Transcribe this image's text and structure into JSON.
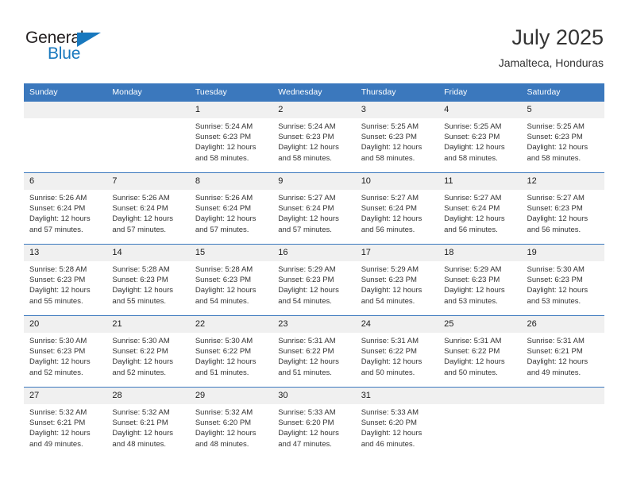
{
  "brand": {
    "name_top": "General",
    "name_bottom": "Blue",
    "color_blue": "#1878be",
    "color_dark": "#231f20"
  },
  "header": {
    "month_title": "July 2025",
    "location": "Jamalteca, Honduras",
    "header_bg": "#3b78bd",
    "date_band_bg": "#f0f0f0"
  },
  "weekdays": [
    "Sunday",
    "Monday",
    "Tuesday",
    "Wednesday",
    "Thursday",
    "Friday",
    "Saturday"
  ],
  "weeks": [
    [
      {
        "day": "",
        "lines": []
      },
      {
        "day": "",
        "lines": []
      },
      {
        "day": "1",
        "lines": [
          "Sunrise: 5:24 AM",
          "Sunset: 6:23 PM",
          "Daylight: 12 hours",
          "and 58 minutes."
        ]
      },
      {
        "day": "2",
        "lines": [
          "Sunrise: 5:24 AM",
          "Sunset: 6:23 PM",
          "Daylight: 12 hours",
          "and 58 minutes."
        ]
      },
      {
        "day": "3",
        "lines": [
          "Sunrise: 5:25 AM",
          "Sunset: 6:23 PM",
          "Daylight: 12 hours",
          "and 58 minutes."
        ]
      },
      {
        "day": "4",
        "lines": [
          "Sunrise: 5:25 AM",
          "Sunset: 6:23 PM",
          "Daylight: 12 hours",
          "and 58 minutes."
        ]
      },
      {
        "day": "5",
        "lines": [
          "Sunrise: 5:25 AM",
          "Sunset: 6:23 PM",
          "Daylight: 12 hours",
          "and 58 minutes."
        ]
      }
    ],
    [
      {
        "day": "6",
        "lines": [
          "Sunrise: 5:26 AM",
          "Sunset: 6:24 PM",
          "Daylight: 12 hours",
          "and 57 minutes."
        ]
      },
      {
        "day": "7",
        "lines": [
          "Sunrise: 5:26 AM",
          "Sunset: 6:24 PM",
          "Daylight: 12 hours",
          "and 57 minutes."
        ]
      },
      {
        "day": "8",
        "lines": [
          "Sunrise: 5:26 AM",
          "Sunset: 6:24 PM",
          "Daylight: 12 hours",
          "and 57 minutes."
        ]
      },
      {
        "day": "9",
        "lines": [
          "Sunrise: 5:27 AM",
          "Sunset: 6:24 PM",
          "Daylight: 12 hours",
          "and 57 minutes."
        ]
      },
      {
        "day": "10",
        "lines": [
          "Sunrise: 5:27 AM",
          "Sunset: 6:24 PM",
          "Daylight: 12 hours",
          "and 56 minutes."
        ]
      },
      {
        "day": "11",
        "lines": [
          "Sunrise: 5:27 AM",
          "Sunset: 6:24 PM",
          "Daylight: 12 hours",
          "and 56 minutes."
        ]
      },
      {
        "day": "12",
        "lines": [
          "Sunrise: 5:27 AM",
          "Sunset: 6:23 PM",
          "Daylight: 12 hours",
          "and 56 minutes."
        ]
      }
    ],
    [
      {
        "day": "13",
        "lines": [
          "Sunrise: 5:28 AM",
          "Sunset: 6:23 PM",
          "Daylight: 12 hours",
          "and 55 minutes."
        ]
      },
      {
        "day": "14",
        "lines": [
          "Sunrise: 5:28 AM",
          "Sunset: 6:23 PM",
          "Daylight: 12 hours",
          "and 55 minutes."
        ]
      },
      {
        "day": "15",
        "lines": [
          "Sunrise: 5:28 AM",
          "Sunset: 6:23 PM",
          "Daylight: 12 hours",
          "and 54 minutes."
        ]
      },
      {
        "day": "16",
        "lines": [
          "Sunrise: 5:29 AM",
          "Sunset: 6:23 PM",
          "Daylight: 12 hours",
          "and 54 minutes."
        ]
      },
      {
        "day": "17",
        "lines": [
          "Sunrise: 5:29 AM",
          "Sunset: 6:23 PM",
          "Daylight: 12 hours",
          "and 54 minutes."
        ]
      },
      {
        "day": "18",
        "lines": [
          "Sunrise: 5:29 AM",
          "Sunset: 6:23 PM",
          "Daylight: 12 hours",
          "and 53 minutes."
        ]
      },
      {
        "day": "19",
        "lines": [
          "Sunrise: 5:30 AM",
          "Sunset: 6:23 PM",
          "Daylight: 12 hours",
          "and 53 minutes."
        ]
      }
    ],
    [
      {
        "day": "20",
        "lines": [
          "Sunrise: 5:30 AM",
          "Sunset: 6:23 PM",
          "Daylight: 12 hours",
          "and 52 minutes."
        ]
      },
      {
        "day": "21",
        "lines": [
          "Sunrise: 5:30 AM",
          "Sunset: 6:22 PM",
          "Daylight: 12 hours",
          "and 52 minutes."
        ]
      },
      {
        "day": "22",
        "lines": [
          "Sunrise: 5:30 AM",
          "Sunset: 6:22 PM",
          "Daylight: 12 hours",
          "and 51 minutes."
        ]
      },
      {
        "day": "23",
        "lines": [
          "Sunrise: 5:31 AM",
          "Sunset: 6:22 PM",
          "Daylight: 12 hours",
          "and 51 minutes."
        ]
      },
      {
        "day": "24",
        "lines": [
          "Sunrise: 5:31 AM",
          "Sunset: 6:22 PM",
          "Daylight: 12 hours",
          "and 50 minutes."
        ]
      },
      {
        "day": "25",
        "lines": [
          "Sunrise: 5:31 AM",
          "Sunset: 6:22 PM",
          "Daylight: 12 hours",
          "and 50 minutes."
        ]
      },
      {
        "day": "26",
        "lines": [
          "Sunrise: 5:31 AM",
          "Sunset: 6:21 PM",
          "Daylight: 12 hours",
          "and 49 minutes."
        ]
      }
    ],
    [
      {
        "day": "27",
        "lines": [
          "Sunrise: 5:32 AM",
          "Sunset: 6:21 PM",
          "Daylight: 12 hours",
          "and 49 minutes."
        ]
      },
      {
        "day": "28",
        "lines": [
          "Sunrise: 5:32 AM",
          "Sunset: 6:21 PM",
          "Daylight: 12 hours",
          "and 48 minutes."
        ]
      },
      {
        "day": "29",
        "lines": [
          "Sunrise: 5:32 AM",
          "Sunset: 6:20 PM",
          "Daylight: 12 hours",
          "and 48 minutes."
        ]
      },
      {
        "day": "30",
        "lines": [
          "Sunrise: 5:33 AM",
          "Sunset: 6:20 PM",
          "Daylight: 12 hours",
          "and 47 minutes."
        ]
      },
      {
        "day": "31",
        "lines": [
          "Sunrise: 5:33 AM",
          "Sunset: 6:20 PM",
          "Daylight: 12 hours",
          "and 46 minutes."
        ]
      },
      {
        "day": "",
        "lines": []
      },
      {
        "day": "",
        "lines": []
      }
    ]
  ]
}
